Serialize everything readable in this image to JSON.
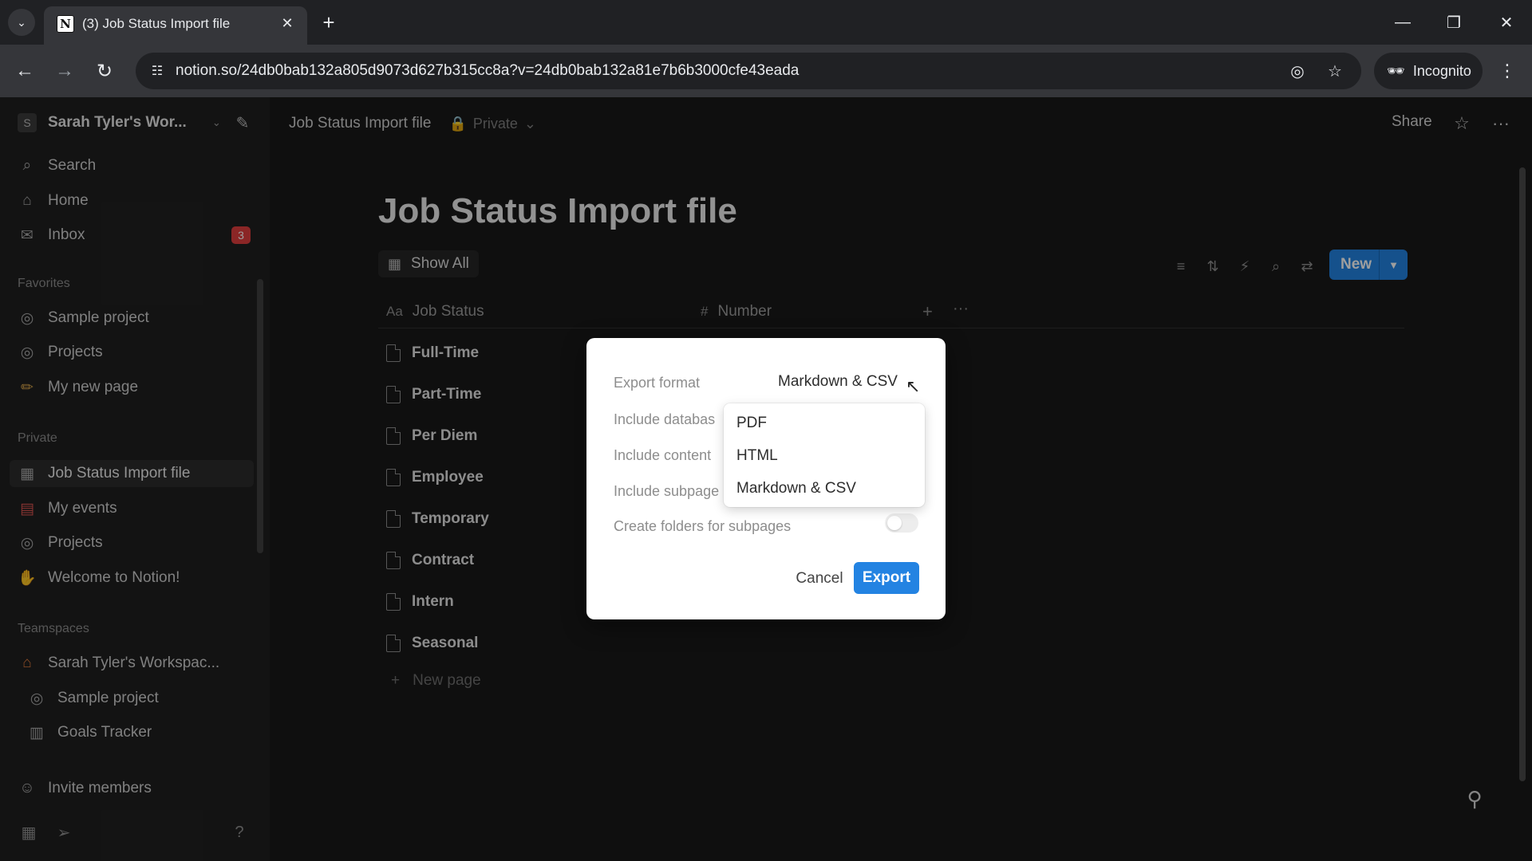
{
  "browser": {
    "tab_title": "(3) Job Status Import file",
    "url": "notion.so/24db0bab132a805d9073d627b315cc8a?v=24db0bab132a81e7b6b3000cfe43eada",
    "incognito_label": "Incognito"
  },
  "sidebar": {
    "workspace_initial": "S",
    "workspace_name": "Sarah Tyler's Wor...",
    "top_items": [
      {
        "label": "Search",
        "icon": "search-icon"
      },
      {
        "label": "Home",
        "icon": "home-icon"
      },
      {
        "label": "Inbox",
        "icon": "inbox-icon",
        "badge": "3"
      }
    ],
    "favorites_heading": "Favorites",
    "favorites": [
      {
        "label": "Sample project",
        "icon": "target-icon"
      },
      {
        "label": "Projects",
        "icon": "target-icon"
      },
      {
        "label": "My new page",
        "icon": "pencil-icon"
      }
    ],
    "private_heading": "Private",
    "private": [
      {
        "label": "Job Status Import file",
        "icon": "table-icon",
        "active": true
      },
      {
        "label": "My events",
        "icon": "calendar-icon"
      },
      {
        "label": "Projects",
        "icon": "target-icon"
      },
      {
        "label": "Welcome to Notion!",
        "icon": "wave-icon"
      }
    ],
    "teamspaces_heading": "Teamspaces",
    "teamspaces": [
      {
        "label": "Sarah Tyler's Workspac...",
        "icon": "house-icon"
      },
      {
        "label": "Sample project",
        "icon": "target-icon"
      },
      {
        "label": "Goals Tracker",
        "icon": "chart-icon"
      }
    ],
    "invite_label": "Invite members"
  },
  "topbar": {
    "breadcrumb": "Job Status Import file",
    "privacy": "Private",
    "share_label": "Share"
  },
  "page": {
    "title": "Job Status Import file",
    "view_label": "Show All",
    "new_label": "New",
    "columns": [
      {
        "icon": "Aa",
        "label": "Job Status"
      },
      {
        "icon": "#",
        "label": "Number"
      }
    ],
    "rows": [
      "Full-Time",
      "Part-Time",
      "Per Diem",
      "Employee",
      "Temporary",
      "Contract",
      "Intern",
      "Seasonal"
    ],
    "new_page_label": "New page"
  },
  "export_modal": {
    "format_label": "Export format",
    "format_value": "Markdown & CSV",
    "include_databases_label": "Include databas",
    "include_content_label": "Include content",
    "include_subpages_label": "Include subpage",
    "create_folders_label": "Create folders for subpages",
    "create_folders_on": false,
    "cancel_label": "Cancel",
    "export_label": "Export",
    "format_options": [
      "PDF",
      "HTML",
      "Markdown & CSV"
    ]
  },
  "colors": {
    "accent": "#2383e2",
    "badge": "#e03e3e"
  }
}
